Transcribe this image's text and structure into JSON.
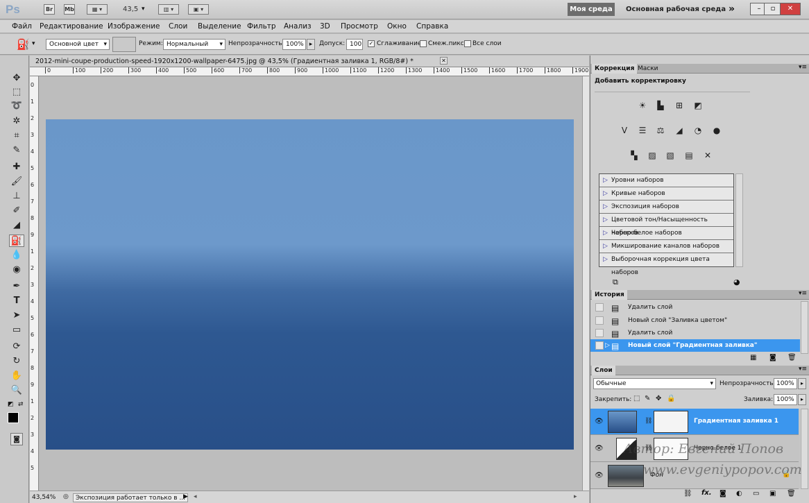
{
  "app": {
    "logo": "Ps",
    "bridge_btn": "Br",
    "minibridge_btn": "Mb",
    "zoom": "43,5",
    "workspace_active": "Моя среда",
    "workspace_main": "Основная рабочая среда",
    "more": "»"
  },
  "menu": [
    "Файл",
    "Редактирование",
    "Изображение",
    "Слои",
    "Выделение",
    "Фильтр",
    "Анализ",
    "3D",
    "Просмотр",
    "Окно",
    "Справка"
  ],
  "options": {
    "source": "Основной цвет",
    "mode_label": "Режим:",
    "mode": "Нормальный",
    "opacity_label": "Непрозрачность:",
    "opacity": "100%",
    "tolerance_label": "Допуск:",
    "tolerance": "100",
    "antialias_label": "Сглаживание",
    "contiguous_label": "Смеж.пикс",
    "all_layers_label": "Все слои"
  },
  "document": {
    "tab_title": "2012-mini-coupe-production-speed-1920x1200-wallpaper-6475.jpg @ 43,5% (Градиентная заливка 1, RGB/8#) *",
    "ruler_h": [
      "0",
      "100",
      "200",
      "300",
      "400",
      "500",
      "600",
      "700",
      "800",
      "900",
      "1000",
      "1100",
      "1200",
      "1300",
      "1400",
      "1500",
      "1600",
      "1700",
      "1800",
      "1900"
    ],
    "ruler_v": [
      "0",
      "1",
      "2",
      "3",
      "4",
      "5",
      "6",
      "7",
      "8",
      "9",
      "1",
      "2",
      "3",
      "4",
      "5",
      "6",
      "7",
      "8",
      "9",
      "1",
      "2",
      "3",
      "4",
      "5"
    ],
    "status_zoom": "43,54%",
    "status_msg": "Экспозиция работает только в ..."
  },
  "adjustments": {
    "tab1": "Коррекция",
    "tab2": "Маски",
    "header": "Добавить корректировку",
    "presets": [
      "Уровни наборов",
      "Кривые наборов",
      "Экспозиция наборов",
      "Цветовой тон/Насыщенность наборов",
      "Черно-белое наборов",
      "Микширование каналов наборов",
      "Выборочная коррекция цвета наборов"
    ]
  },
  "history": {
    "tab": "История",
    "items": [
      {
        "label": "Удалить слой",
        "selected": false
      },
      {
        "label": "Новый слой \"Заливка цветом\"",
        "selected": false
      },
      {
        "label": "Удалить слой",
        "selected": false
      },
      {
        "label": "Новый слой \"Градиентная заливка\"",
        "selected": true
      }
    ]
  },
  "layers": {
    "tab": "Слои",
    "blend": "Обычные",
    "opacity_label": "Непрозрачность:",
    "opacity": "100%",
    "lock_label": "Закрепить:",
    "fill_label": "Заливка:",
    "fill": "100%",
    "items": [
      {
        "name": "Градиентная заливка 1",
        "selected": true
      },
      {
        "name": "Черно-белое 1",
        "selected": false
      },
      {
        "name": "Фон",
        "selected": false
      }
    ],
    "fx": "fx."
  },
  "watermark": {
    "author": "Автор: Евгений Попов",
    "site": "www.evgeniypopov.com"
  },
  "colors": {
    "selection": "#3b96ee",
    "image_top": "#6a97c9",
    "image_bottom": "#284f88"
  }
}
